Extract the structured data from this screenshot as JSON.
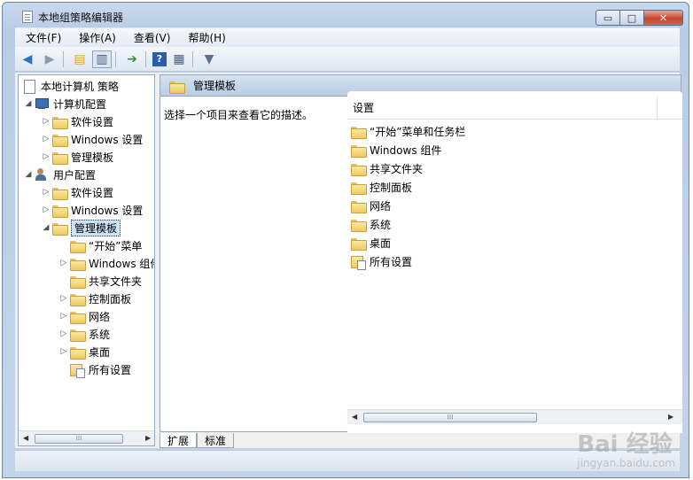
{
  "window": {
    "title": "本地组策略编辑器",
    "buttons": {
      "minimize": "▭",
      "maximize": "□",
      "close": "✕"
    }
  },
  "menu": [
    "文件(F)",
    "操作(A)",
    "查看(V)",
    "帮助(H)"
  ],
  "toolbar": {
    "icons": [
      "back-icon",
      "forward-icon",
      "up-folder-icon",
      "show-hide-tree-icon",
      "export-list-icon",
      "help-icon",
      "properties-icon",
      "filter-icon"
    ]
  },
  "tree": {
    "root": "本地计算机 策略",
    "computer_config": "计算机配置",
    "computer_children": [
      "软件设置",
      "Windows 设置",
      "管理模板"
    ],
    "user_config": "用户配置",
    "user_children": [
      "软件设置",
      "Windows 设置",
      "管理模板"
    ],
    "admin_children": [
      "“开始”菜单",
      "Windows 组件",
      "共享文件夹",
      "控制面板",
      "网络",
      "系统",
      "桌面",
      "所有设置"
    ]
  },
  "right": {
    "header": "管理模板",
    "description": "选择一个项目来查看它的描述。",
    "column_header": "设置",
    "items": [
      "“开始”菜单和任务栏",
      "Windows 组件",
      "共享文件夹",
      "控制面板",
      "网络",
      "系统",
      "桌面",
      "所有设置"
    ]
  },
  "tabs": [
    "扩展",
    "标准"
  ],
  "watermark": {
    "brand": "Bai 经验",
    "url": "jingyan.baidu.com"
  },
  "colors": {
    "selection": "#cde3f7",
    "header": "#b9cde5",
    "folder": "#f0c95d"
  }
}
